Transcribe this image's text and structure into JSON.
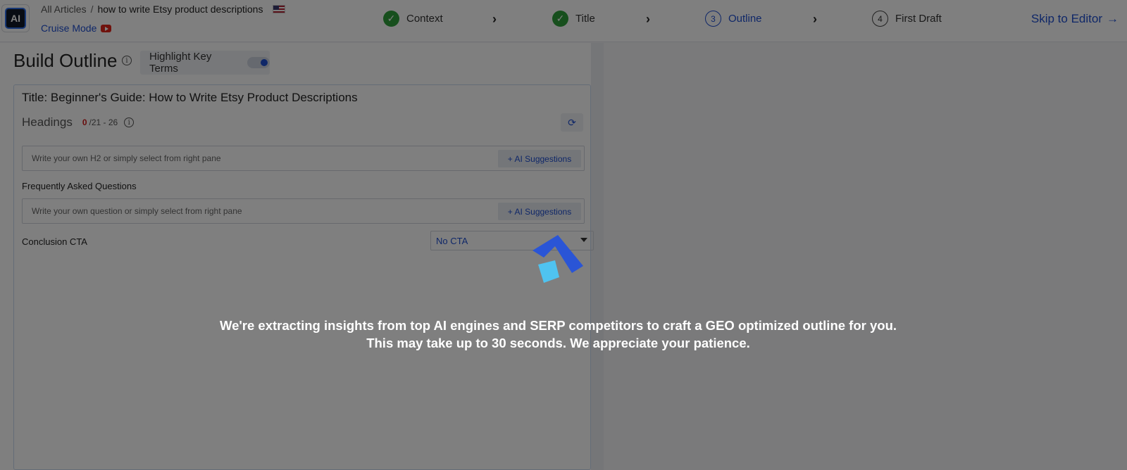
{
  "breadcrumb": {
    "root": "All Articles",
    "separator": "/",
    "current": "how to write Etsy product descriptions"
  },
  "cruise_mode": {
    "label": "Cruise Mode"
  },
  "steps": [
    {
      "label": "Context",
      "state": "done"
    },
    {
      "label": "Title",
      "state": "done"
    },
    {
      "number": "3",
      "label": "Outline",
      "state": "active"
    },
    {
      "number": "4",
      "label": "First Draft",
      "state": "pending"
    }
  ],
  "skip": {
    "label": "Skip to Editor",
    "arrow": "→"
  },
  "outline": {
    "page_title": "Build Outline",
    "highlight_label": "Highlight Key Terms",
    "highlight_on": true,
    "article_title": "Title: Beginner's Guide: How to Write Etsy Product Descriptions",
    "headings_label": "Headings",
    "count_current": "0",
    "count_range": "/21 - 26",
    "h2_placeholder": "Write your own H2 or simply select from right pane",
    "ai_suggestions_label": "+ AI Suggestions",
    "faq_label": "Frequently Asked Questions",
    "faq_placeholder": "Write your own question or simply select from right pane",
    "cta_label": "Conclusion CTA",
    "cta_value": "No CTA"
  },
  "loading": {
    "line1": "We're extracting insights from top AI engines and SERP competitors to craft a GEO optimized outline for you.",
    "line2": "This may take up to 30 seconds. We appreciate your patience."
  },
  "colors": {
    "accent": "#1f4fd1",
    "success": "#2f9e3a",
    "error": "#d11a1a"
  }
}
